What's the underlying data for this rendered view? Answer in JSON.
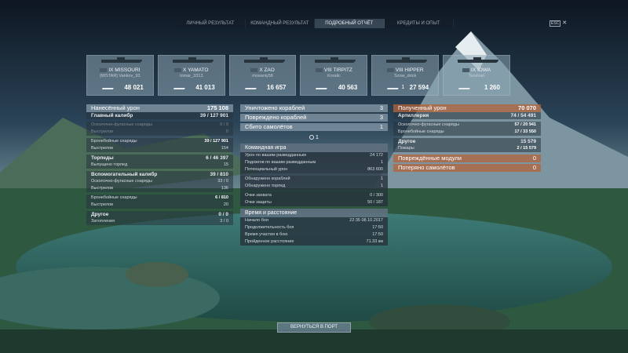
{
  "tabs": [
    "ЛИЧНЫЙ РЕЗУЛЬТАТ",
    "КОМАНДНЫЙ РЕЗУЛЬТАТ",
    "ПОДРОБНЫЙ ОТЧЁТ",
    "КРЕДИТЫ И ОПЫТ"
  ],
  "active_tab": "ПОДРОБНЫЙ ОТЧЁТ",
  "close_label": "ESC",
  "ships": [
    {
      "name": "IX MISSOURI",
      "player": "[WSTAR] Vankov_93",
      "damage": "48 021",
      "kills": ""
    },
    {
      "name": "X YAMATO",
      "player": "tomar_3313",
      "damage": "41 013",
      "kills": ""
    },
    {
      "name": "X ZAO",
      "player": "mosaniy58",
      "damage": "16 657",
      "kills": ""
    },
    {
      "name": "VIII TIRPITZ",
      "player": "Koralic",
      "damage": "40 563",
      "kills": ""
    },
    {
      "name": "VIII HIPPER",
      "player": "Szow_drick",
      "damage": "27 594",
      "kills": "1"
    },
    {
      "name": "IX IOWA",
      "player": "Tanimari",
      "damage": "1 260",
      "kills": ""
    }
  ],
  "left": {
    "dealt": {
      "label": "Нанесённый урон",
      "value": "175 108"
    },
    "main_cal": {
      "label": "Главный калибр",
      "value": "39 / 127 901"
    },
    "he_main": {
      "label": "Осколочно-фугасные снаряды",
      "value": "0 / 0"
    },
    "shots_he_main": {
      "label": "Выстрелов",
      "value": "0"
    },
    "ap_main": {
      "label": "Бронебойные снаряды",
      "value": "39 / 127 901"
    },
    "shots_ap_main": {
      "label": "Выстрелов",
      "value": "154"
    },
    "torps": {
      "label": "Торпеды",
      "value": "6 / 46 397"
    },
    "torps_launched": {
      "label": "Выпущено торпед",
      "value": "15"
    },
    "secondary": {
      "label": "Вспомогательный калибр",
      "value": "39 / 810"
    },
    "he_sec": {
      "label": "Осколочно-фугасные снаряды",
      "value": "33 / 0"
    },
    "shots_he_sec": {
      "label": "Выстрелов",
      "value": "136"
    },
    "ap_sec": {
      "label": "Бронебойные снаряды",
      "value": "6 / 810"
    },
    "shots_ap_sec": {
      "label": "Выстрелов",
      "value": "20"
    },
    "other": {
      "label": "Другое",
      "value": "0 / 0"
    },
    "flooding": {
      "label": "Затопления",
      "value": "3 / 0"
    }
  },
  "middle": {
    "destroyed": {
      "label": "Уничтожено кораблей",
      "value": "3"
    },
    "damaged": {
      "label": "Повреждено кораблей",
      "value": "3"
    },
    "planes": {
      "label": "Сбито самолётов",
      "value": "1"
    },
    "plane_count": "1",
    "team_title": "Командная игра",
    "team_rows": [
      {
        "label": "Урон по вашим разведданным",
        "value": "24 172"
      },
      {
        "label": "Подожгов по вашим разведданным",
        "value": "1"
      },
      {
        "label": "Потенциальный урон",
        "value": "863 600"
      },
      {
        "label": "Обнаружено кораблей",
        "value": "1"
      },
      {
        "label": "Обнаружено торпед",
        "value": "1"
      },
      {
        "label": "Очки захвата",
        "value": "0 / 300"
      },
      {
        "label": "Очки защиты",
        "value": "50 / 187"
      }
    ],
    "time_title": "Время и расстояние",
    "time_rows": [
      {
        "label": "Начало боя",
        "value": "22:35  08.10.2017"
      },
      {
        "label": "Продолжительность боя",
        "value": "17:50"
      },
      {
        "label": "Время участия в бою",
        "value": "17:50"
      },
      {
        "label": "Пройденное расстояние",
        "value": "71.33 км"
      }
    ]
  },
  "right": {
    "received": {
      "label": "Полученный урон",
      "value": "70 070"
    },
    "artillery": {
      "label": "Артиллерия",
      "value": "74 / 54 491"
    },
    "he": {
      "label": "Осколочно-фугасные снаряды",
      "value": "57 / 20 941"
    },
    "ap": {
      "label": "Бронебойные снаряды",
      "value": "17 / 33 550"
    },
    "other": {
      "label": "Другое",
      "value": "15 579"
    },
    "fires": {
      "label": "Пожары",
      "value": "2 / 15 579"
    },
    "modules": {
      "label": "Повреждённые модули",
      "value": "0"
    },
    "planes_lost": {
      "label": "Потеряно самолётов",
      "value": "0"
    }
  },
  "return_button": "ВЕРНУТЬСЯ В ПОРТ"
}
